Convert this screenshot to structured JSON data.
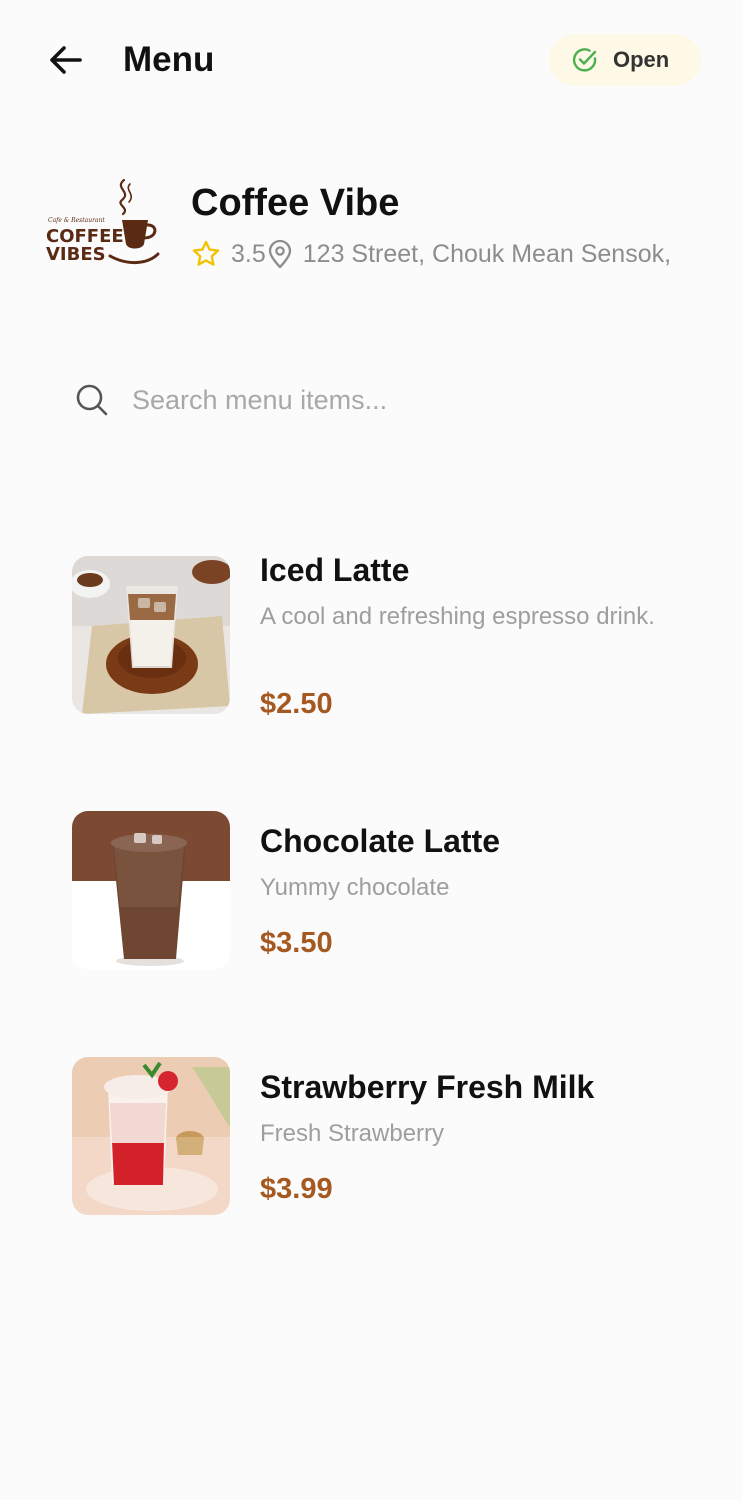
{
  "header": {
    "title": "Menu",
    "status": "Open"
  },
  "shop": {
    "name": "Coffee Vibe",
    "rating": "3.5",
    "address": "123 Street, Chouk Mean Sensok,",
    "logo_text_line1": "COFFEE",
    "logo_text_line2": "VIBES",
    "logo_tagline": "Cafe & Restaurant"
  },
  "search": {
    "placeholder": "Search menu items..."
  },
  "items": [
    {
      "name": "Iced Latte",
      "description": "A cool and refreshing espresso drink.",
      "price": "$2.50"
    },
    {
      "name": "Chocolate Latte",
      "description": "Yummy chocolate",
      "price": "$3.50"
    },
    {
      "name": "Strawberry Fresh Milk",
      "description": "Fresh Strawberry",
      "price": "$3.99"
    }
  ],
  "colors": {
    "price": "#a5581f",
    "status_bg": "#fdf9e6",
    "status_check": "#4caf50",
    "star": "#f2c200",
    "logo_brown": "#5a2a12"
  },
  "icons": {
    "back": "arrow-left-icon",
    "status": "check-circle-icon",
    "rating": "star-icon",
    "location": "map-pin-icon",
    "search": "search-icon"
  }
}
